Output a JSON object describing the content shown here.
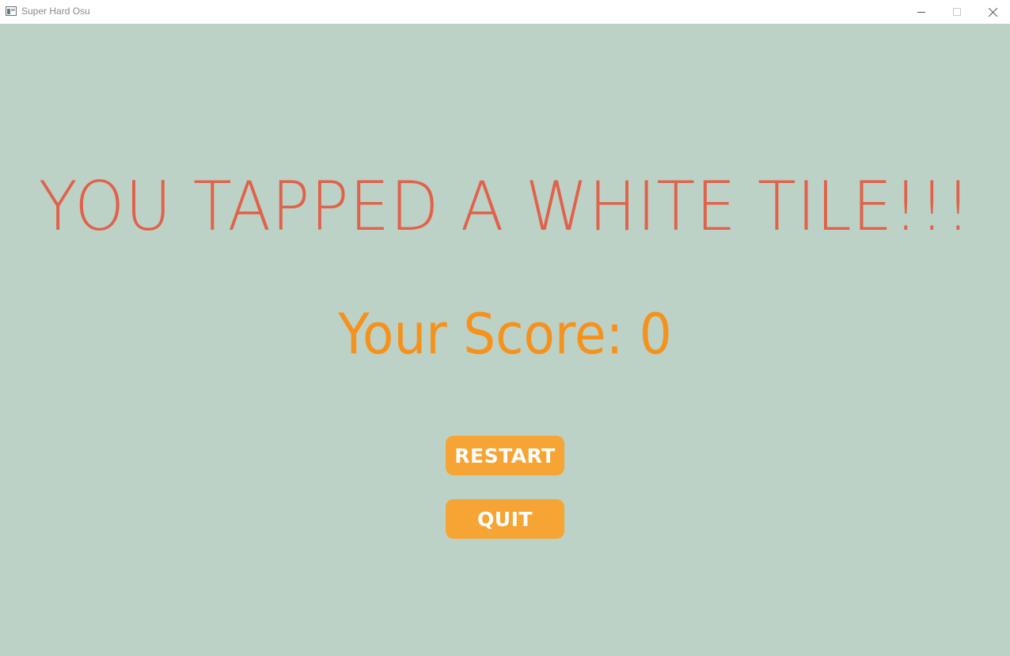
{
  "window": {
    "title": "Super Hard Osu",
    "icon": "app-window-icon",
    "controls": {
      "minimize": "minimize-icon",
      "maximize": "maximize-icon",
      "close": "close-icon"
    }
  },
  "game_over": {
    "headline": "YOU TAPPED A WHITE TILE!!!",
    "score_text": "Your Score: 0",
    "buttons": {
      "restart_label": "RESTART",
      "quit_label": "QUIT"
    }
  },
  "colors": {
    "background": "#bdd2c6",
    "headline": "#e0624a",
    "score": "#f5921d",
    "button": "#f6a434",
    "button_text": "#ffffff"
  }
}
